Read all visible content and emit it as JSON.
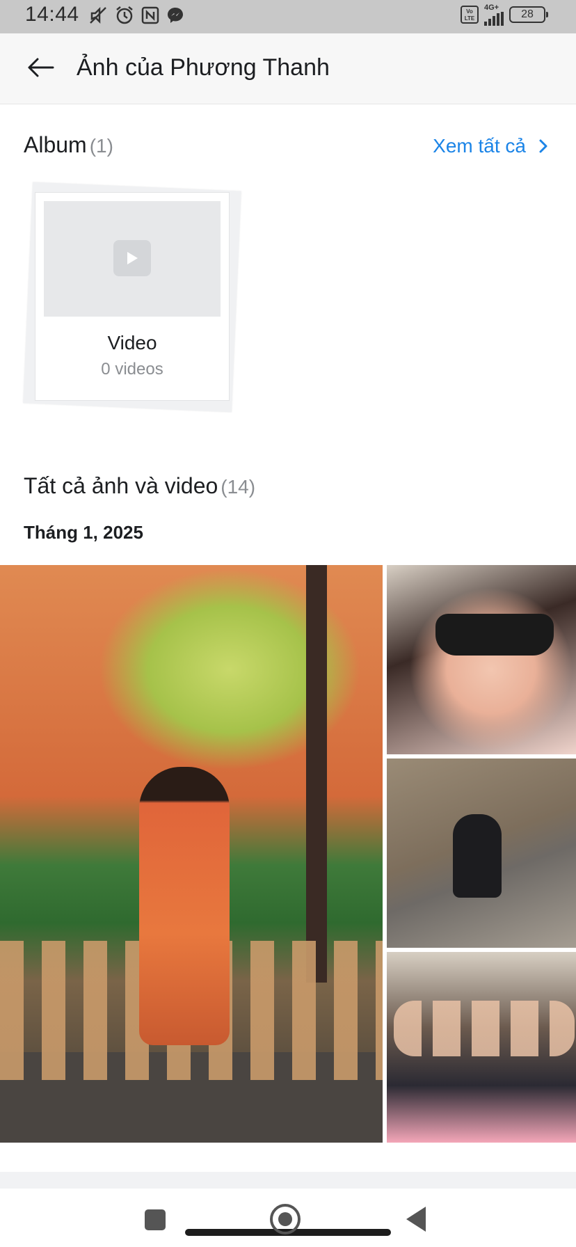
{
  "status_bar": {
    "time": "14:44",
    "network_label": "4G+",
    "volte_label": "Vo LTE",
    "battery": "28",
    "icons": [
      "mute-icon",
      "alarm-icon",
      "nfc-icon",
      "messenger-icon"
    ]
  },
  "header": {
    "title": "Ảnh của Phương Thanh",
    "back_icon": "arrow-left-icon"
  },
  "album_section": {
    "title": "Album",
    "count": "(1)",
    "see_all_label": "Xem tất cả",
    "albums": [
      {
        "name": "Video",
        "count_label": "0 videos"
      }
    ]
  },
  "photos_section": {
    "title": "Tất cả ảnh và video",
    "count": "(14)",
    "month_label": "Tháng 1, 2025"
  },
  "colors": {
    "accent": "#1b84e7",
    "muted_text": "#8a8d91",
    "header_bg": "#f7f7f7",
    "status_bar_bg": "#c8c8c8"
  }
}
